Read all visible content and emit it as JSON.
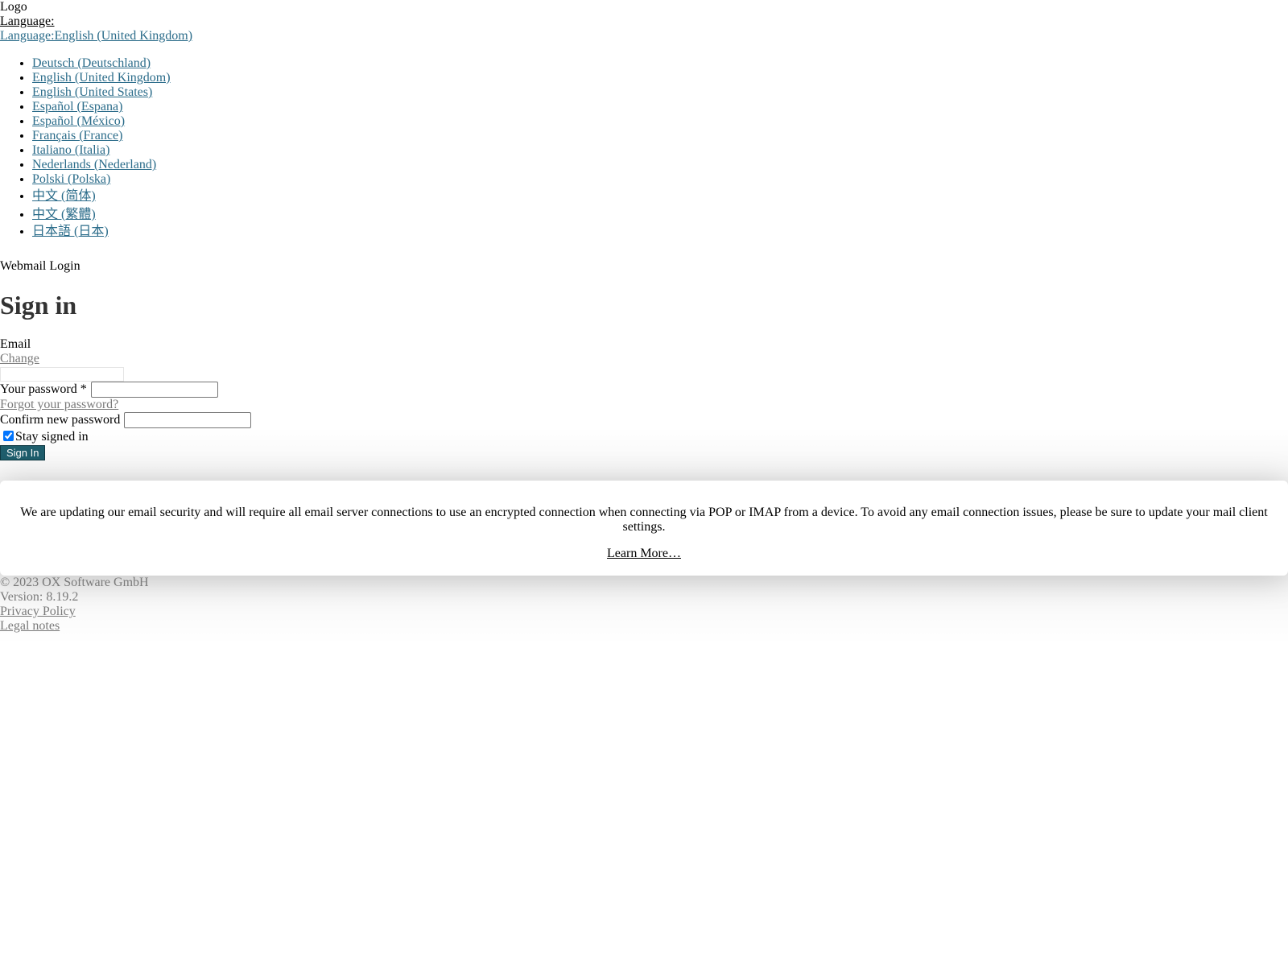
{
  "header": {
    "logo_alt": "Logo",
    "language_label": "Language:",
    "language_current": "Language:English (United Kingdom)"
  },
  "languages": [
    "Deutsch (Deutschland)",
    "English (United Kingdom)",
    "English (United States)",
    "Español (Espana)",
    "Español (México)",
    "Français (France)",
    "Italiano (Italia)",
    "Nederlands (Nederland)",
    "Polski (Polska)",
    "中文 (简体)",
    "中文 (繁體)",
    "日本語 (日本)"
  ],
  "login": {
    "subtitle": "Webmail Login",
    "heading": "Sign in",
    "email_label": "Email",
    "change_link": "Change",
    "email_value": "",
    "password_label": "Your password *",
    "forgot_link": "Forgot your password?",
    "confirm_label": "Confirm new password",
    "stay_signed_in_label": "Stay signed in",
    "stay_signed_in_checked": true,
    "submit_label": "Sign In"
  },
  "notice": {
    "message": "We are updating our email security and will require all email server connections to use an encrypted connection when connecting via POP or IMAP from a device. To avoid any email connection issues, please be sure to update your mail client settings.",
    "link": "Learn More…"
  },
  "footer": {
    "copyright": "© 2023 OX Software GmbH",
    "version": "Version: 8.19.2",
    "privacy": "Privacy Policy",
    "legal": "Legal notes"
  },
  "colors": {
    "link": "#2b6c8a",
    "muted_link": "#7a7a7a",
    "primary_button": "#1f5f6e"
  }
}
